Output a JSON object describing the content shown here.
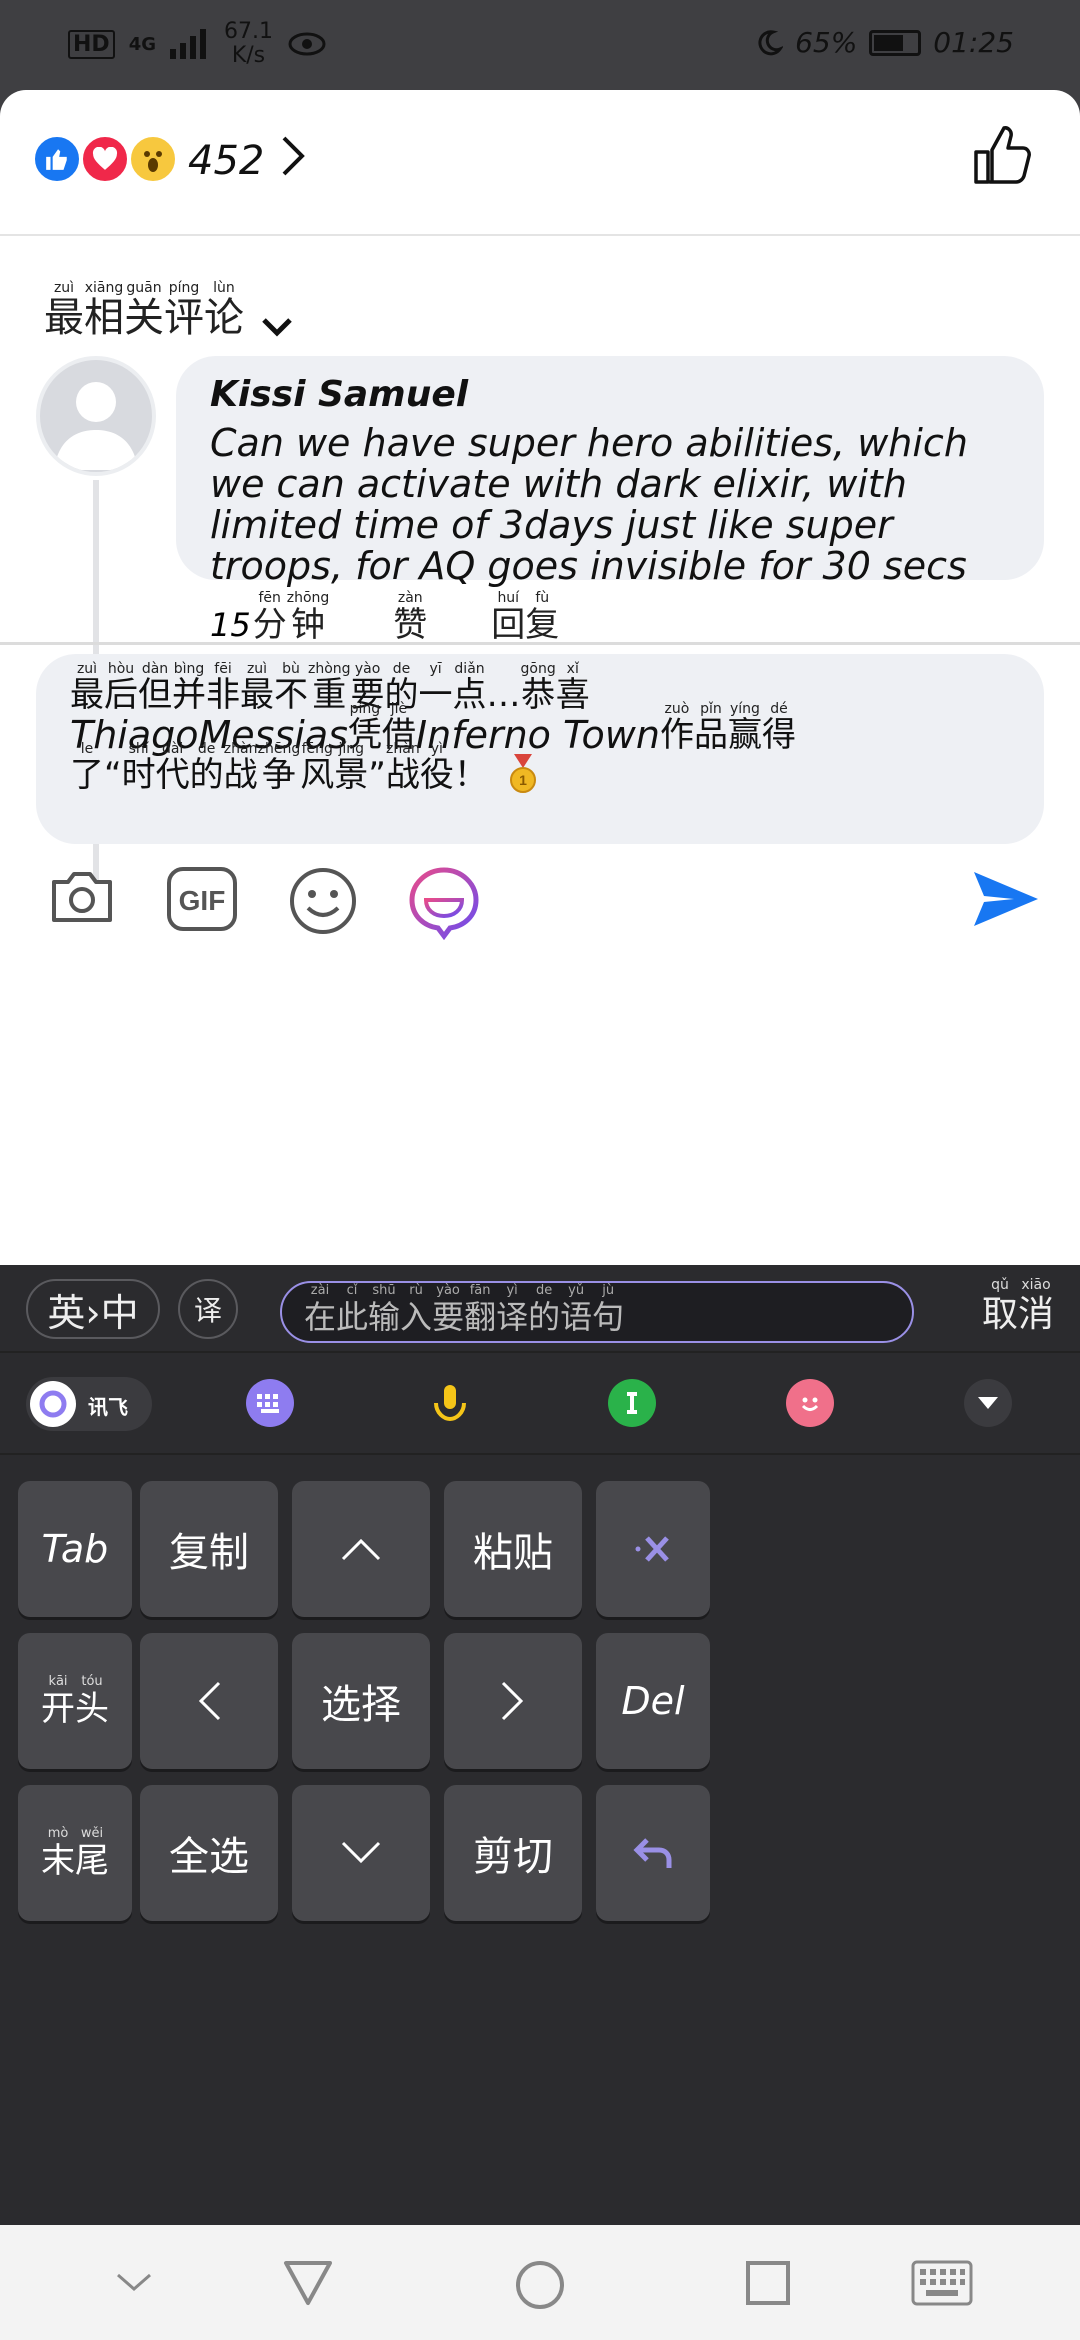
{
  "status": {
    "hd": "HD",
    "signal": "4G",
    "speed_value": "67.1",
    "speed_unit": "K/s",
    "battery": "65%",
    "battery_level": 0.65,
    "time": "01:25"
  },
  "reactions": {
    "count": "452"
  },
  "sort": {
    "label": [
      {
        "hz": "最",
        "py": "zuì"
      },
      {
        "hz": "相",
        "py": "xiāng"
      },
      {
        "hz": "关",
        "py": "guān"
      },
      {
        "hz": "评",
        "py": "píng"
      },
      {
        "hz": "论",
        "py": "lùn"
      }
    ]
  },
  "comment": {
    "author": "Kissi Samuel",
    "text": "Can we have super hero abilities, which we can activate with dark elixir, with limited time of 3days just like super troops, for AQ goes invisible for 30 secs",
    "time_num": "15",
    "time_unit": [
      {
        "hz": "分",
        "py": "fēn"
      },
      {
        "hz": "钟",
        "py": "zhōng"
      }
    ],
    "like": [
      {
        "hz": "赞",
        "py": "zàn"
      }
    ],
    "reply": [
      {
        "hz": "回",
        "py": "huí"
      },
      {
        "hz": "复",
        "py": "fù"
      }
    ]
  },
  "compose": {
    "line1": [
      {
        "hz": "最",
        "py": "zuì"
      },
      {
        "hz": "后",
        "py": "hòu"
      },
      {
        "hz": "但",
        "py": "dàn"
      },
      {
        "hz": "并",
        "py": "bìng"
      },
      {
        "hz": "非",
        "py": "fēi"
      },
      {
        "hz": "最",
        "py": "zuì"
      },
      {
        "hz": "不",
        "py": "bù"
      },
      {
        "hz": "重",
        "py": "zhòng"
      },
      {
        "hz": "要",
        "py": "yào"
      },
      {
        "hz": "的",
        "py": "de"
      },
      {
        "hz": "一",
        "py": "yī"
      },
      {
        "hz": "点",
        "py": "diǎn"
      },
      {
        "hz": "…",
        "py": ""
      },
      {
        "hz": "恭",
        "py": "gōng"
      },
      {
        "hz": "喜",
        "py": "xǐ"
      }
    ],
    "line2_latin1": "ThiagoMessias",
    "line2_a": [
      {
        "hz": "凭",
        "py": "píng"
      },
      {
        "hz": "借",
        "py": "jiè"
      }
    ],
    "line2_latin2": "Inferno Town",
    "line2_b": [
      {
        "hz": "作",
        "py": "zuò"
      },
      {
        "hz": "品",
        "py": "pǐn"
      },
      {
        "hz": "赢",
        "py": "yíng"
      },
      {
        "hz": "得",
        "py": "dé"
      }
    ],
    "line3": [
      {
        "hz": "了",
        "py": "le"
      },
      {
        "hz": "“",
        "py": ""
      },
      {
        "hz": "时",
        "py": "shí"
      },
      {
        "hz": "代",
        "py": "dài"
      },
      {
        "hz": "的",
        "py": "de"
      },
      {
        "hz": "战",
        "py": "zhàn"
      },
      {
        "hz": "争",
        "py": "zhēng"
      },
      {
        "hz": "风",
        "py": "fēng"
      },
      {
        "hz": "景",
        "py": "jǐng"
      },
      {
        "hz": "”",
        "py": ""
      },
      {
        "hz": "战",
        "py": "zhàn"
      },
      {
        "hz": "役",
        "py": "yì"
      },
      {
        "hz": "！",
        "py": ""
      }
    ]
  },
  "ime": {
    "lang_toggle": "英›中",
    "translate_icon": "译",
    "translate_placeholder": [
      {
        "hz": "在",
        "py": "zài"
      },
      {
        "hz": "此",
        "py": "cǐ"
      },
      {
        "hz": "输",
        "py": "shū"
      },
      {
        "hz": "入",
        "py": "rù"
      },
      {
        "hz": "要",
        "py": "yào"
      },
      {
        "hz": "翻",
        "py": "fān"
      },
      {
        "hz": "译",
        "py": "yì"
      },
      {
        "hz": "的",
        "py": "de"
      },
      {
        "hz": "语",
        "py": "yǔ"
      },
      {
        "hz": "句",
        "py": "jù"
      }
    ],
    "cancel": [
      {
        "hz": "取",
        "py": "qǔ"
      },
      {
        "hz": "消",
        "py": "xiāo"
      }
    ],
    "brand": "讯飞",
    "keys": {
      "tab": "Tab",
      "copy": "复制",
      "paste": "粘贴",
      "select": "选择",
      "del": "Del",
      "select_all": "全选",
      "cut": "剪切",
      "home": [
        {
          "hz": "开",
          "py": "kāi"
        },
        {
          "hz": "头",
          "py": "tóu"
        }
      ],
      "end": [
        {
          "hz": "末",
          "py": "mò"
        },
        {
          "hz": "尾",
          "py": "wěi"
        }
      ]
    }
  },
  "colors": {
    "accent_blue": "#1877f2",
    "bubble_bg": "#eef0f4",
    "ime_bg": "#2b2b2e",
    "key_bg": "#48484c",
    "ime_accent": "#9a90e6"
  },
  "icons": [
    "like-reaction-icon",
    "love-reaction-icon",
    "wow-reaction-icon",
    "chevron-right-icon",
    "thumbs-up-icon",
    "chevron-down-icon",
    "camera-icon",
    "gif-icon",
    "emoji-icon",
    "sticker-icon",
    "send-icon"
  ]
}
